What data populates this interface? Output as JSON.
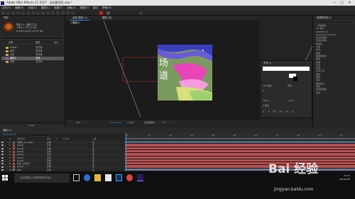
{
  "window": {
    "title": "Adobe After Effects CC 2017 - 无标题项目.aep *",
    "controls": [
      "—",
      "□",
      "✕"
    ]
  },
  "menu": [
    "文件(F)",
    "编辑(E)",
    "合成(C)",
    "图层(L)",
    "效果(T)",
    "动画(A)",
    "视图(V)",
    "窗口",
    "帮助(H)"
  ],
  "project": {
    "tab": "项目",
    "comp_name": "场景1 ▾，使用了1次",
    "comp_size": "1280 x 720 (1.00)",
    "comp_duration": "Δ 0;00;10;00, 29.97 fps",
    "search_placeholder": "",
    "columns": [
      "名称",
      "类型",
      "大小"
    ],
    "items": [
      {
        "icon": "folder",
        "name": "Solids",
        "type": "文件夹"
      },
      {
        "icon": "folder",
        "name": "素材",
        "type": "文件夹"
      },
      {
        "icon": "folder",
        "name": "元素",
        "type": "文件夹"
      },
      {
        "icon": "comp",
        "name": "场景1",
        "type": "合成",
        "selected": true
      },
      {
        "icon": "folder",
        "name": "字体",
        "type": "文件夹"
      }
    ],
    "footer": "8 bpc"
  },
  "viewer": {
    "tabs": [
      "合成 场景1 ≡",
      "图层 (无)"
    ],
    "breadcrumb": "场景1",
    "art_text": "场道",
    "footer_zoom": "50%",
    "footer_time": "0;00;00;00",
    "footer_quality": "二分之一",
    "footer_view": "活动摄像机",
    "footer_views": "1个..."
  },
  "effects_panel": {
    "tab": "效果和预设 ≡",
    "items": [
      "* 动画预设",
      "3D 通道",
      "CINEMA 4D",
      "Synthetic Aperture",
      "表达式控制",
      "沉浸式视频",
      "风格化",
      "过渡",
      "过时",
      "抠像",
      "模糊和锐化",
      "模拟",
      "扭曲",
      "生成",
      "时间",
      "实用工具",
      "通道",
      "透视",
      "文本",
      "颜色校正",
      "音频",
      "杂色和颗粒",
      "遮罩"
    ]
  },
  "character_panel": {
    "tab": "字符 ≡",
    "font_name": "",
    "size": "100 像素",
    "leading": "自动",
    "tracking": "0",
    "vertical_scale": "100 %",
    "horizontal_scale": "100 %",
    "baseline": "0 像素",
    "styles": [
      "T",
      "T",
      "TT",
      "Tт",
      "T¹",
      "T₁"
    ]
  },
  "timeline": {
    "tab": "场景1 ≡",
    "current_time": "0;00;00;00",
    "columns": [
      "#",
      "图层名称",
      "模式",
      "T",
      "TrkMat",
      "父级"
    ],
    "layers": [
      {
        "num": "1",
        "name": "[场景1_01.mp4]",
        "mode": "正常",
        "parent": "无",
        "color": "#4a6a8a"
      },
      {
        "num": "2",
        "name": "[Solid]",
        "mode": "正常",
        "parent": "无",
        "color": "#b85050"
      },
      {
        "num": "3",
        "name": "[Solid]",
        "mode": "正常",
        "parent": "无",
        "color": "#b85050"
      },
      {
        "num": "4",
        "name": "[Solid]",
        "mode": "正常",
        "parent": "无",
        "color": "#b85050"
      },
      {
        "num": "5",
        "name": "[Solid]",
        "mode": "正常",
        "parent": "无",
        "color": "#b85050"
      },
      {
        "num": "6",
        "name": "[Solid]",
        "mode": "正常",
        "parent": "无",
        "color": "#b85050"
      },
      {
        "num": "7",
        "name": "[Solid]",
        "mode": "正常",
        "parent": "无",
        "color": "#b85050"
      },
      {
        "num": "8",
        "name": "场道（文字层）",
        "mode": "正常",
        "parent": "无",
        "color": "#b85050"
      },
      {
        "num": "9",
        "name": "[Solid]",
        "mode": "正常",
        "parent": "无",
        "color": "#b85050"
      },
      {
        "num": "10",
        "name": "[BG]",
        "mode": "正常",
        "parent": "无",
        "color": "#6a7a9a"
      }
    ],
    "ruler": [
      "0s",
      "01s",
      "02s",
      "03s",
      "04s",
      "05s",
      "06s",
      "07s",
      "08s",
      "09s",
      "10s"
    ]
  },
  "taskbar": {
    "search": "在这里输入你要搜索的内容",
    "time": "19:43",
    "date": "2018/2/26"
  },
  "watermark": {
    "text": "Bai 经验",
    "url": "jingyan.baidu.com"
  },
  "colors": {
    "accent_blue": "#2d8ceb",
    "layer_red": "#b85050",
    "bar_blue": "#4a6a8a",
    "playhead": "#3a8ee6"
  }
}
